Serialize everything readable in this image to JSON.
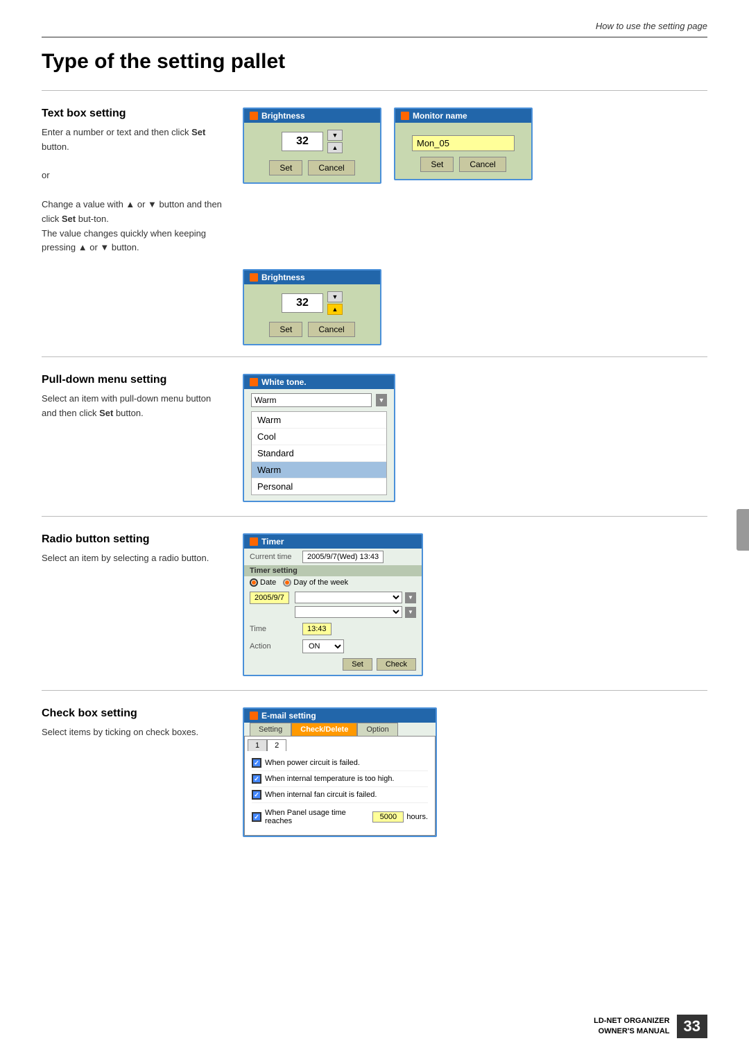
{
  "header": {
    "subtitle": "How to use the setting page"
  },
  "page": {
    "title": "Type of the setting pallet"
  },
  "sections": [
    {
      "id": "text-box",
      "title": "Text box setting",
      "desc_parts": [
        {
          "text": "Enter a number or text and then click ",
          "bold": false
        },
        {
          "text": "Set",
          "bold": true
        },
        {
          "text": " button.",
          "bold": false
        }
      ],
      "or_text": "or",
      "desc2_parts": [
        {
          "text": "Change a value with ▲ or ▼ button and then click ",
          "bold": false
        },
        {
          "text": "Set",
          "bold": true
        },
        {
          "text": " but-ton.\nThe value changes quickly when keeping pressing ▲ or ▼ button.",
          "bold": false
        }
      ]
    },
    {
      "id": "pulldown",
      "title": "Pull-down menu setting",
      "desc_parts": [
        {
          "text": "Select an item with pull-down menu button and then click ",
          "bold": false
        },
        {
          "text": "Set",
          "bold": true
        },
        {
          "text": " button.",
          "bold": false
        }
      ]
    },
    {
      "id": "radio",
      "title": "Radio button setting",
      "desc": "Select an item by selecting a radio button."
    },
    {
      "id": "checkbox",
      "title": "Check box setting",
      "desc": "Select items by ticking on check boxes."
    }
  ],
  "widgets": {
    "brightness1": {
      "header": "Brightness",
      "value": "32",
      "set_label": "Set",
      "cancel_label": "Cancel"
    },
    "brightness2": {
      "header": "Brightness",
      "value": "32",
      "set_label": "Set",
      "cancel_label": "Cancel"
    },
    "monitor": {
      "header": "Monitor name",
      "value": "Mon_05",
      "set_label": "Set",
      "cancel_label": "Cancel"
    },
    "tone": {
      "header": "White tone.",
      "dropdown_value": "Warm",
      "items": [
        "Warm",
        "Cool",
        "Standard",
        "Warm",
        "Personal"
      ],
      "selected_index": 3
    },
    "timer": {
      "header": "Timer",
      "current_time_label": "Current time",
      "current_time_value": "2005/9/7(Wed) 13:43",
      "timer_setting_label": "Timer setting",
      "date_label": "Date",
      "day_of_week_label": "Day of the week",
      "date_value": "2005/9/7",
      "time_label": "Time",
      "time_value": "13:43",
      "action_label": "Action",
      "action_value": "ON",
      "set_label": "Set",
      "check_label": "Check"
    },
    "email": {
      "header": "E-mail setting",
      "tabs": [
        "Setting",
        "Check/Delete",
        "Option"
      ],
      "active_tab": "Check/Delete",
      "sub_tabs": [
        "1",
        "2"
      ],
      "active_sub_tab": "2",
      "items": [
        {
          "text": "When power circuit is failed.",
          "checked": true
        },
        {
          "text": "When internal temperature is too high.",
          "checked": true
        },
        {
          "text": "When internal fan circuit is failed.",
          "checked": true
        },
        {
          "text": "When Panel usage time reaches",
          "checked": true,
          "has_input": true,
          "input_value": "5000",
          "suffix": "hours."
        }
      ]
    }
  },
  "footer": {
    "brand": "LD-NET ORGANIZER",
    "manual": "OWNER'S MANUAL",
    "page_number": "33"
  }
}
